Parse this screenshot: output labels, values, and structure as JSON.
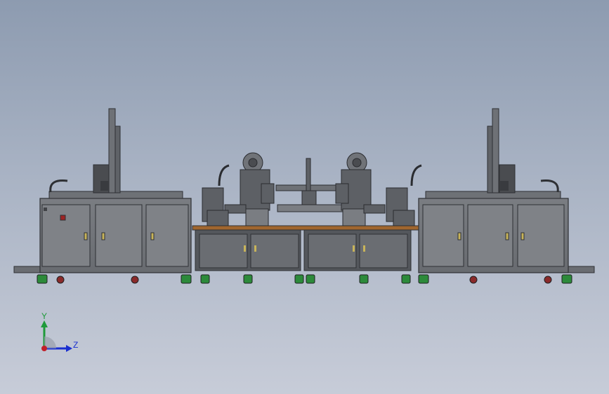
{
  "triad": {
    "y_label": "Y",
    "z_label": "Z",
    "y_color": "#1f9a3a",
    "z_color": "#1a2fd0",
    "origin_color": "#c0202a"
  },
  "colors": {
    "frame": "#5f6267",
    "panel": "#74777c",
    "dark": "#3b3d41",
    "wood": "#a0662e",
    "wheel_green": "#2c8a3a",
    "wheel_red": "#8a2a2a"
  }
}
